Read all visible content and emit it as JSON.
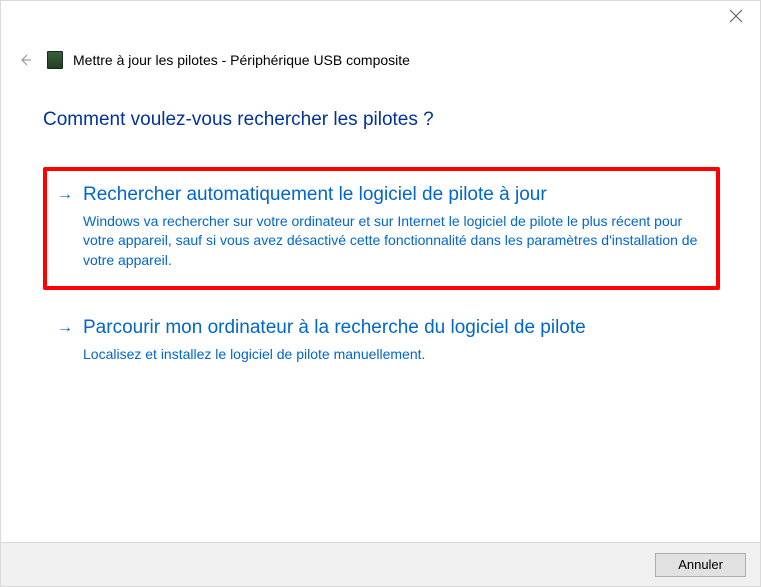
{
  "header": {
    "title": "Mettre à jour les pilotes - Périphérique USB composite"
  },
  "question": "Comment voulez-vous rechercher les pilotes ?",
  "options": {
    "auto": {
      "title": "Rechercher automatiquement le logiciel de pilote à jour",
      "desc": "Windows va rechercher sur votre ordinateur et sur Internet le logiciel de pilote le plus récent pour votre appareil, sauf si vous avez désactivé cette fonctionnalité dans les paramètres d'installation de votre appareil."
    },
    "browse": {
      "title": "Parcourir mon ordinateur à la recherche du logiciel de pilote",
      "desc": "Localisez et installez le logiciel de pilote manuellement."
    }
  },
  "footer": {
    "cancel_label": "Annuler"
  }
}
